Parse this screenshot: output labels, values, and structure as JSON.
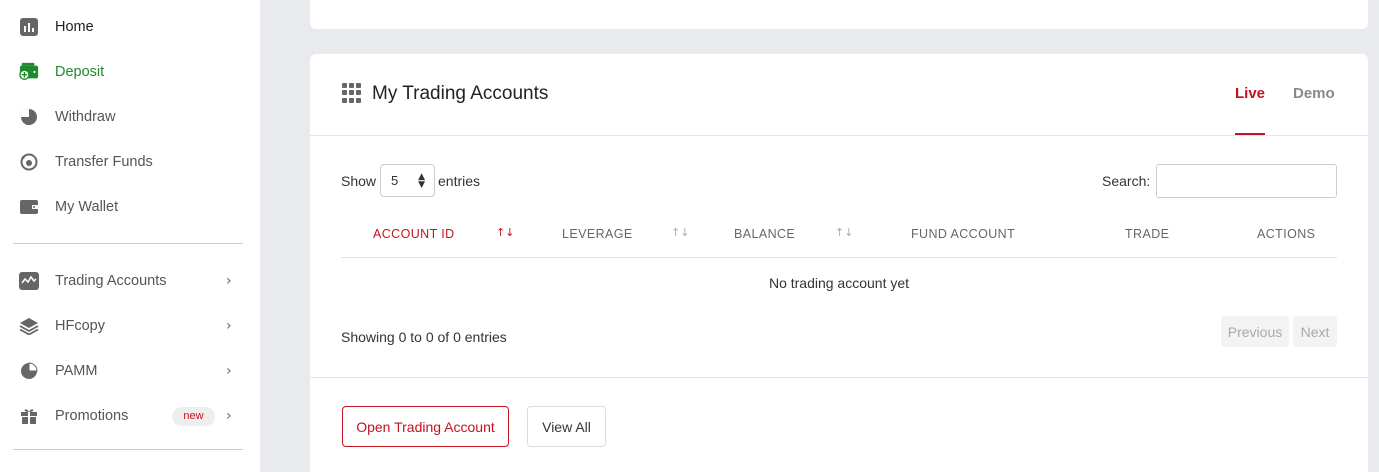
{
  "sidebar": {
    "items": [
      {
        "label": "Home",
        "icon": "bar-chart-icon"
      },
      {
        "label": "Deposit",
        "icon": "wallet-plus-icon"
      },
      {
        "label": "Withdraw",
        "icon": "pie-icon"
      },
      {
        "label": "Transfer Funds",
        "icon": "transfer-icon"
      },
      {
        "label": "My Wallet",
        "icon": "wallet-icon"
      }
    ],
    "group_items": [
      {
        "label": "Trading Accounts",
        "icon": "chart-line-icon",
        "chevron": "›"
      },
      {
        "label": "HFcopy",
        "icon": "layers-icon",
        "chevron": "›"
      },
      {
        "label": "PAMM",
        "icon": "pie-chart-icon",
        "chevron": "›"
      },
      {
        "label": "Promotions",
        "icon": "gift-icon",
        "chevron": "›",
        "badge": "new"
      }
    ]
  },
  "card": {
    "title": "My Trading Accounts",
    "tabs": {
      "live": "Live",
      "demo": "Demo"
    },
    "show_label": "Show",
    "page_size": "5",
    "entries_label": "entries",
    "search_label": "Search:",
    "columns": [
      "ACCOUNT ID",
      "LEVERAGE",
      "BALANCE",
      "FUND ACCOUNT",
      "TRADE",
      "ACTIONS"
    ],
    "empty_message": "No trading account yet",
    "showing_text": "Showing 0 to 0 of 0 entries",
    "previous_label": "Previous",
    "next_label": "Next",
    "open_account_label": "Open Trading Account",
    "view_all_label": "View All"
  },
  "colors": {
    "accent": "#c4121f",
    "deposit_green": "#1e8a2c",
    "background": "#e9eaee"
  }
}
